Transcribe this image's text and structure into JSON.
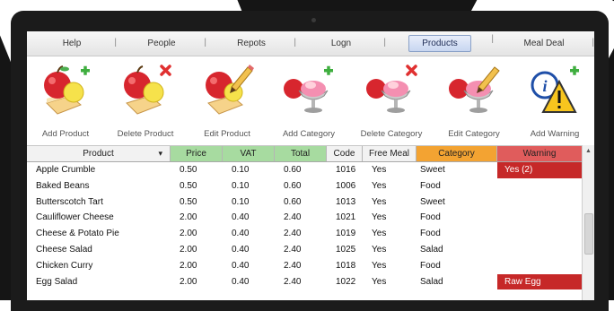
{
  "menu": {
    "items": [
      {
        "label": "Help",
        "active": false
      },
      {
        "label": "People",
        "active": false
      },
      {
        "label": "Repots",
        "active": false
      },
      {
        "label": "Logn",
        "active": false
      },
      {
        "label": "Products",
        "active": true
      },
      {
        "label": "Meal Deal",
        "active": false
      }
    ]
  },
  "toolbar": {
    "items": [
      {
        "label": "Add Product",
        "icon": "apple-cake-add-icon",
        "badge": "plus"
      },
      {
        "label": "Delete Product",
        "icon": "apple-cake-delete-icon",
        "badge": "cross"
      },
      {
        "label": "Edit Product",
        "icon": "apple-cake-edit-icon",
        "badge": "pencil"
      },
      {
        "label": "Add Category",
        "icon": "dessert-cup-add-icon",
        "badge": "plus"
      },
      {
        "label": "Delete Category",
        "icon": "dessert-cup-delete-icon",
        "badge": "cross"
      },
      {
        "label": "Edit Category",
        "icon": "dessert-cup-edit-icon",
        "badge": "pencil"
      },
      {
        "label": "Add Warning",
        "icon": "info-warning-add-icon",
        "badge": "plus"
      }
    ]
  },
  "table": {
    "columns": [
      {
        "label": "Product",
        "dropdown": "▾",
        "bg": "#f2f2f2"
      },
      {
        "label": "Price",
        "bg": "#a7dba0"
      },
      {
        "label": "VAT",
        "bg": "#a7dba0"
      },
      {
        "label": "Total",
        "bg": "#a7dba0"
      },
      {
        "label": "Code",
        "bg": "#f2f2f2"
      },
      {
        "label": "Free Meal",
        "bg": "#f2f2f2"
      },
      {
        "label": "Category",
        "bg": "#f3a332"
      },
      {
        "label": "Warning",
        "bg": "#e05c5c"
      }
    ],
    "rows": [
      {
        "product": "Apple Crumble",
        "price": "0.50",
        "vat": "0.10",
        "total": "0.60",
        "code": "1016",
        "free": "Yes",
        "category": "Sweet",
        "warning": "Yes (2)"
      },
      {
        "product": "Baked Beans",
        "price": "0.50",
        "vat": "0.10",
        "total": "0.60",
        "code": "1006",
        "free": "Yes",
        "category": "Food",
        "warning": ""
      },
      {
        "product": "Butterscotch Tart",
        "price": "0.50",
        "vat": "0.10",
        "total": "0.60",
        "code": "1013",
        "free": "Yes",
        "category": "Sweet",
        "warning": ""
      },
      {
        "product": "Cauliflower Cheese",
        "price": "2.00",
        "vat": "0.40",
        "total": "2.40",
        "code": "1021",
        "free": "Yes",
        "category": "Food",
        "warning": ""
      },
      {
        "product": "Cheese & Potato Pie",
        "price": "2.00",
        "vat": "0.40",
        "total": "2.40",
        "code": "1019",
        "free": "Yes",
        "category": "Food",
        "warning": ""
      },
      {
        "product": "Cheese Salad",
        "price": "2.00",
        "vat": "0.40",
        "total": "2.40",
        "code": "1025",
        "free": "Yes",
        "category": "Salad",
        "warning": ""
      },
      {
        "product": "Chicken Curry",
        "price": "2.00",
        "vat": "0.40",
        "total": "2.40",
        "code": "1018",
        "free": "Yes",
        "category": "Food",
        "warning": ""
      },
      {
        "product": "Egg Salad",
        "price": "2.00",
        "vat": "0.40",
        "total": "2.40",
        "code": "1022",
        "free": "Yes",
        "category": "Salad",
        "warning": "Raw Egg"
      },
      {
        "product": "",
        "price": "",
        "vat": "",
        "total": "",
        "code": "",
        "free": "",
        "category": "",
        "warning": ""
      }
    ]
  },
  "colors": {
    "warning_fill": "#c62828",
    "price_header": "#a7dba0",
    "category_header": "#f3a332",
    "warning_header": "#e05c5c",
    "active_menu": "#c8d6f0"
  }
}
